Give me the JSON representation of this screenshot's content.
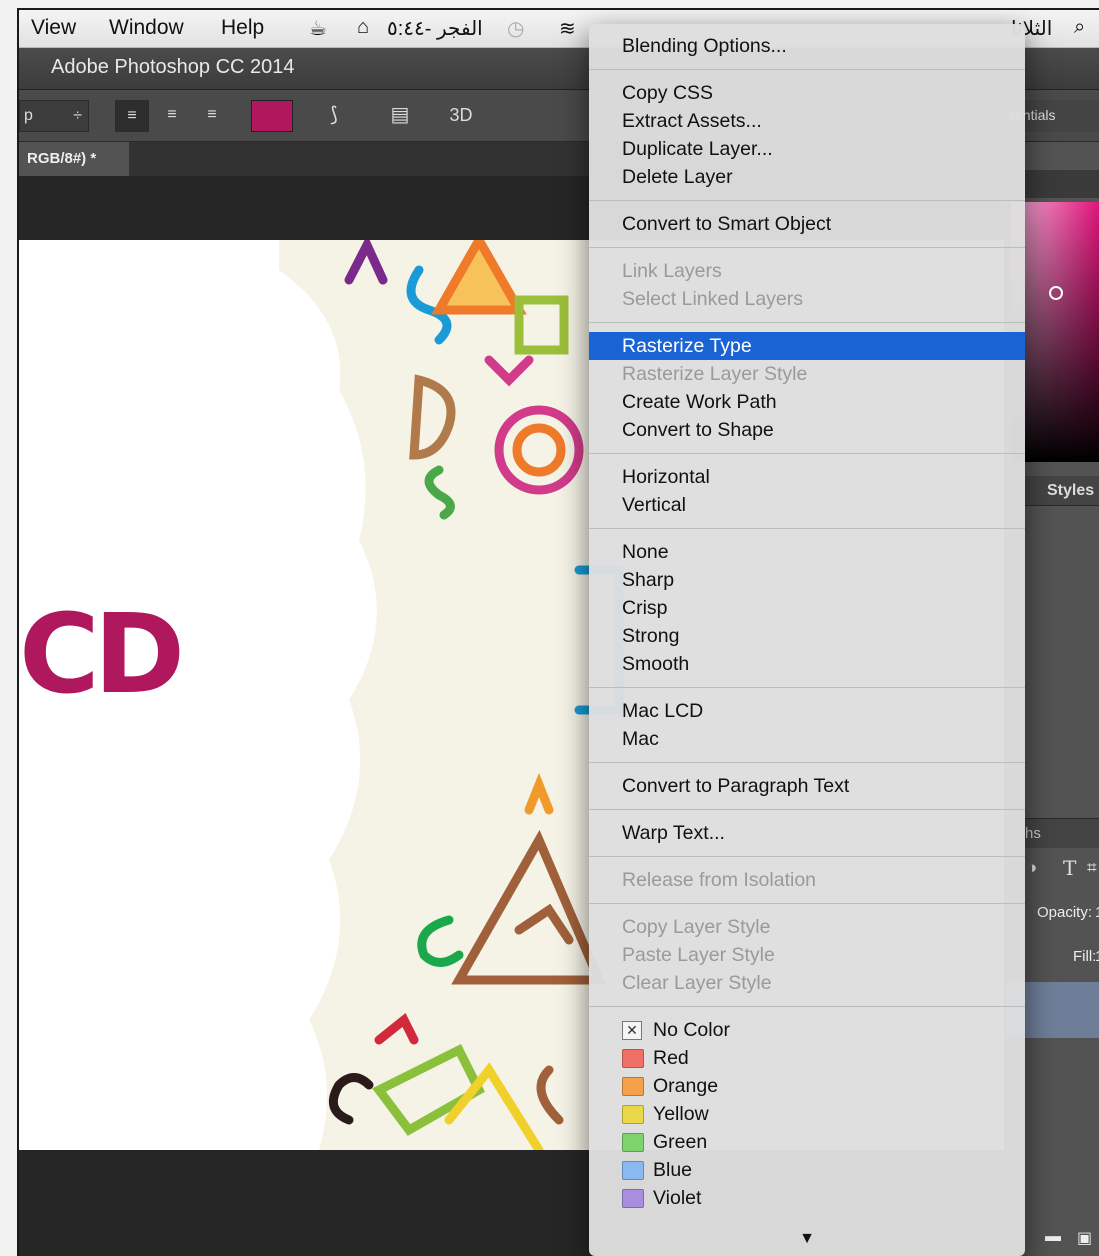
{
  "menubar": {
    "items": [
      "View",
      "Window",
      "Help"
    ],
    "status_arabic_time": "الفجر -٥:٤٤",
    "status_day": "الثلاثا"
  },
  "titlebar": {
    "title": "Adobe Photoshop CC 2014"
  },
  "options": {
    "font_field": "p",
    "three_d": "3D",
    "workspace": "sentials"
  },
  "document": {
    "tab_label": "RGB/8#) *",
    "canvas_text": "CD",
    "text_color": "#b0185e"
  },
  "panels": {
    "styles_tab": "Styles",
    "paths_tab": "hs",
    "type_icon": "T",
    "opacity_label": "Opacity:",
    "opacity_value": "1",
    "fill_label": "Fill:",
    "fill_value": "1"
  },
  "context_menu": {
    "groups": [
      [
        {
          "label": "Blending Options...",
          "enabled": true
        }
      ],
      [
        {
          "label": "Copy CSS",
          "enabled": true
        },
        {
          "label": "Extract Assets...",
          "enabled": true
        },
        {
          "label": "Duplicate Layer...",
          "enabled": true
        },
        {
          "label": "Delete Layer",
          "enabled": true
        }
      ],
      [
        {
          "label": "Convert to Smart Object",
          "enabled": true
        }
      ],
      [
        {
          "label": "Link Layers",
          "enabled": false
        },
        {
          "label": "Select Linked Layers",
          "enabled": false
        }
      ],
      [
        {
          "label": "Rasterize Type",
          "enabled": true,
          "highlighted": true
        },
        {
          "label": "Rasterize Layer Style",
          "enabled": false
        },
        {
          "label": "Create Work Path",
          "enabled": true
        },
        {
          "label": "Convert to Shape",
          "enabled": true
        }
      ],
      [
        {
          "label": "Horizontal",
          "enabled": true
        },
        {
          "label": "Vertical",
          "enabled": true
        }
      ],
      [
        {
          "label": "None",
          "enabled": true
        },
        {
          "label": "Sharp",
          "enabled": true
        },
        {
          "label": "Crisp",
          "enabled": true
        },
        {
          "label": "Strong",
          "enabled": true
        },
        {
          "label": "Smooth",
          "enabled": true
        }
      ],
      [
        {
          "label": "Mac LCD",
          "enabled": true
        },
        {
          "label": "Mac",
          "enabled": true
        }
      ],
      [
        {
          "label": "Convert to Paragraph Text",
          "enabled": true
        }
      ],
      [
        {
          "label": "Warp Text...",
          "enabled": true
        }
      ],
      [
        {
          "label": "Release from Isolation",
          "enabled": false
        }
      ],
      [
        {
          "label": "Copy Layer Style",
          "enabled": false
        },
        {
          "label": "Paste Layer Style",
          "enabled": false
        },
        {
          "label": "Clear Layer Style",
          "enabled": false
        }
      ]
    ],
    "colors": [
      {
        "label": "No Color",
        "swatch": "none"
      },
      {
        "label": "Red",
        "swatch": "#f07068"
      },
      {
        "label": "Orange",
        "swatch": "#f5a04a"
      },
      {
        "label": "Yellow",
        "swatch": "#e8d84a"
      },
      {
        "label": "Green",
        "swatch": "#7ed46a"
      },
      {
        "label": "Blue",
        "swatch": "#8ab8f0"
      },
      {
        "label": "Violet",
        "swatch": "#a98ee0"
      }
    ],
    "more_arrow": "▼"
  }
}
